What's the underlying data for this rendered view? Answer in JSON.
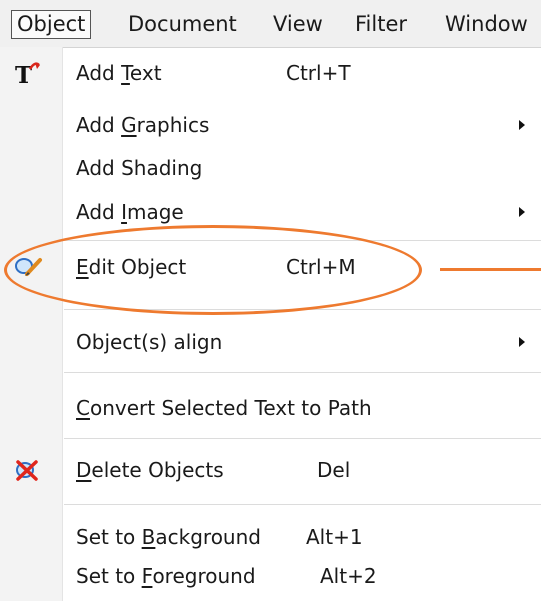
{
  "menubar": {
    "items": [
      {
        "label": "Object",
        "active": true
      },
      {
        "label": "Document",
        "active": false
      },
      {
        "label": "View",
        "active": false
      },
      {
        "label": "Filter",
        "active": false
      },
      {
        "label": "Window",
        "active": false
      }
    ]
  },
  "menu": {
    "items": [
      {
        "label_pre": "Add ",
        "mnemonic": "T",
        "label_post": "ext",
        "shortcut": "Ctrl+T",
        "icon": "text-tool-icon"
      },
      {
        "label_pre": "Add ",
        "mnemonic": "G",
        "label_post": "raphics",
        "submenu": true
      },
      {
        "label_pre": "Add Shading",
        "mnemonic": "",
        "label_post": ""
      },
      {
        "label_pre": "Add ",
        "mnemonic": "I",
        "label_post": "mage",
        "submenu": true
      },
      {
        "label_pre": "",
        "mnemonic": "E",
        "label_post": "dit Object",
        "shortcut": "Ctrl+M",
        "icon": "edit-object-icon",
        "highlighted": true
      },
      {
        "label_pre": "Object(s) align",
        "mnemonic": "",
        "label_post": "",
        "submenu": true
      },
      {
        "label_pre": "",
        "mnemonic": "C",
        "label_post": "onvert Selected Text to Path"
      },
      {
        "label_pre": "",
        "mnemonic": "D",
        "label_post": "elete Objects",
        "shortcut": "Del",
        "icon": "delete-objects-icon"
      },
      {
        "label_pre": "Set to ",
        "mnemonic": "B",
        "label_post": "ackground",
        "shortcut": "Alt+1"
      },
      {
        "label_pre": "Set to ",
        "mnemonic": "F",
        "label_post": "oreground",
        "shortcut": "Alt+2"
      }
    ]
  },
  "annotation": {
    "color": "#ee7a2f"
  }
}
